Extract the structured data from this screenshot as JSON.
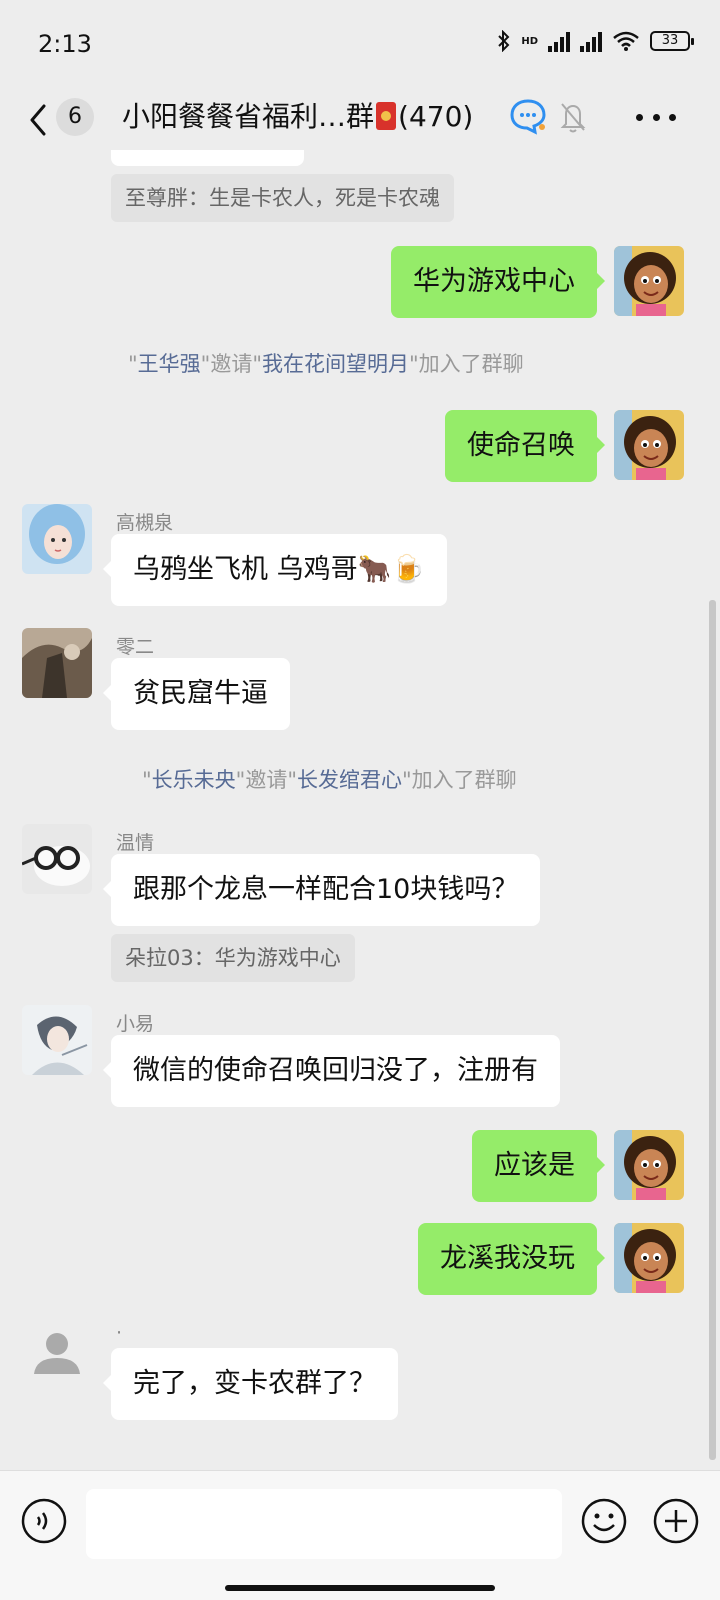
{
  "status_bar": {
    "time": "2:13",
    "hd_label": "HD",
    "battery": "33",
    "icons": [
      "bluetooth-icon",
      "signal-icon",
      "wifi-icon",
      "battery-icon"
    ]
  },
  "header": {
    "unread_count": "6",
    "title_prefix": "小阳餐餐省福利…群",
    "title_suffix": "(470)",
    "icons": [
      "back-arrow-icon",
      "red-envelope-icon",
      "ai-chat-icon",
      "mute-bell-icon",
      "more-dots-icon"
    ]
  },
  "messages": {
    "quote1": "至尊胖：生是卡农人，死是卡农魂",
    "self1": "华为游戏中心",
    "sys1": {
      "p1": "\"",
      "inviter": "王华强",
      "p2": "\"邀请\"",
      "invitee": "我在花间望明月",
      "p3": "\"加入了群聊"
    },
    "self2": "使命召唤",
    "m1": {
      "sender": "高槻泉",
      "text": "乌鸦坐飞机 乌鸡哥🐂🍺"
    },
    "m2": {
      "sender": "零二",
      "text": "贫民窟牛逼"
    },
    "sys2": {
      "p1": "\"",
      "inviter": "长乐未央",
      "p2": "\"邀请\"",
      "invitee": "长发绾君心",
      "p3": "\"加入了群聊"
    },
    "m3": {
      "sender": "温情",
      "text": "跟那个龙息一样配合10块钱吗？",
      "quote": "朵拉03：华为游戏中心"
    },
    "m4": {
      "sender": "小易",
      "text": "微信的使命召唤回归没了，注册有"
    },
    "self3": "应该是",
    "self4": "龙溪我没玩",
    "m5": {
      "sender": "·",
      "text": "完了，变卡农群了？"
    }
  },
  "input_bar": {
    "placeholder": "",
    "icons": [
      "voice-icon",
      "emoji-icon",
      "plus-icon"
    ]
  },
  "colors": {
    "background": "#ededed",
    "self_bubble": "#95ec69",
    "other_bubble": "#ffffff",
    "link_name": "#576b95"
  }
}
